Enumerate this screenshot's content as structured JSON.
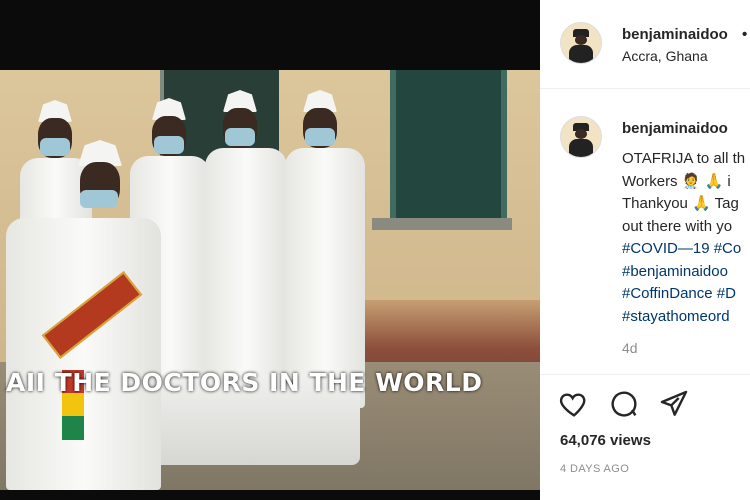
{
  "video": {
    "caption": "AII THE DOCTORS IN THE WORLD"
  },
  "post": {
    "username": "benjaminaidoo",
    "header_separator": "•",
    "location": "Accra, Ghana"
  },
  "comment": {
    "username": "benjaminaidoo",
    "lines": [
      "OTAFRIJA to all th",
      "Workers 🧑‍⚕️ 🙏 i",
      "Thankyou 🙏 Tag",
      "out there with yo"
    ],
    "hashtags": [
      "#COVID—19 #Co",
      "#benjaminaidoo",
      "#CoffinDance #D",
      "#stayathomeord"
    ],
    "time": "4d"
  },
  "actions": {
    "like_icon": "heart-icon",
    "comment_icon": "comment-icon",
    "share_icon": "share-icon"
  },
  "stats": {
    "views": "64,076 views",
    "date": "4 DAYS AGO"
  }
}
